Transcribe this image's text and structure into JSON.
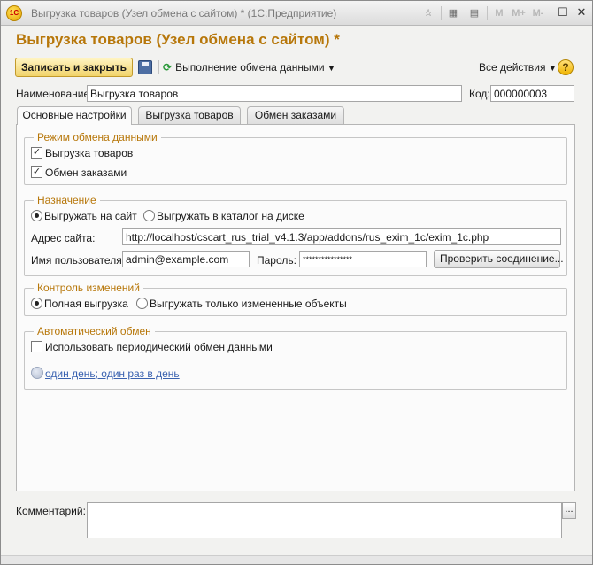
{
  "window": {
    "title": "Выгрузка товаров (Узел обмена с сайтом) * (1С:Предприятие)",
    "logo": "1С",
    "memory_buttons": [
      "M",
      "M+",
      "M-"
    ]
  },
  "form": {
    "title": "Выгрузка товаров (Узел обмена с сайтом) *"
  },
  "toolbar": {
    "save_close_label": "Записать и закрыть",
    "exchange_label": "Выполнение обмена данными",
    "all_actions_label": "Все действия",
    "help_label": "?"
  },
  "header_fields": {
    "name_label": "Наименование:",
    "name_value": "Выгрузка товаров",
    "code_label": "Код:",
    "code_value": "000000003"
  },
  "tabs": [
    {
      "label": "Основные настройки"
    },
    {
      "label": "Выгрузка товаров"
    },
    {
      "label": "Обмен заказами"
    }
  ],
  "exchange_mode": {
    "title": "Режим обмена данными",
    "export_goods_label": "Выгрузка товаров",
    "export_goods_checked": true,
    "orders_label": "Обмен заказами",
    "orders_checked": true
  },
  "destination": {
    "title": "Назначение",
    "to_site_label": "Выгружать на сайт",
    "to_disk_label": "Выгружать в каталог на диске",
    "selected": "to_site",
    "site_address_label": "Адрес сайта:",
    "site_address_value": "http://localhost/cscart_rus_trial_v4.1.3/app/addons/rus_exim_1c/exim_1c.php",
    "username_label": "Имя пользователя:",
    "username_value": "admin@example.com",
    "password_label": "Пароль:",
    "password_value": "****************",
    "check_connection_label": "Проверить соединение..."
  },
  "change_control": {
    "title": "Контроль изменений",
    "full_label": "Полная выгрузка",
    "changed_only_label": "Выгружать только измененные объекты",
    "selected": "full"
  },
  "auto_exchange": {
    "title": "Автоматический обмен",
    "periodic_label": "Использовать периодический обмен данными",
    "periodic_checked": false,
    "schedule_link": "один день; один раз в день"
  },
  "comment": {
    "label": "Комментарий:",
    "value": "",
    "button_label": "..."
  },
  "icons": {
    "sync": "sync-icon",
    "save": "floppy-disk-icon",
    "schedule": "schedule-icon",
    "dropdown": "chevron-down-icon"
  },
  "colors": {
    "title_accent": "#b7770a",
    "link": "#3a62b0",
    "primary_button": "#f1d36a"
  }
}
